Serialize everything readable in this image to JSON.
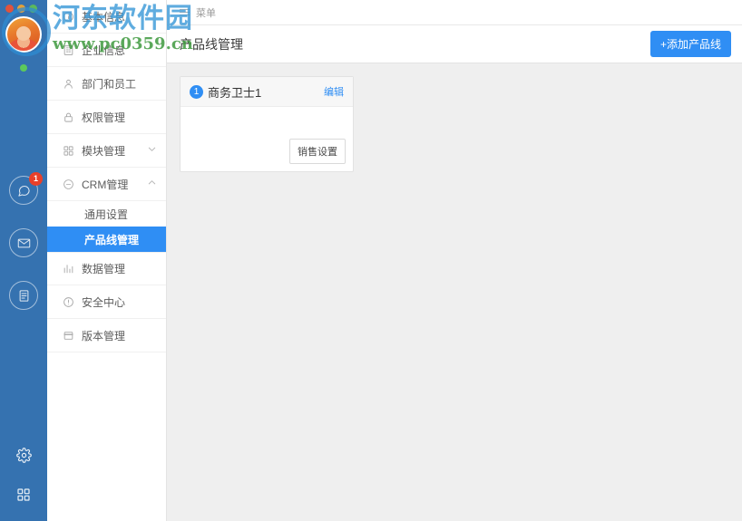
{
  "window": {
    "traffic_lights": [
      {
        "name": "close",
        "color": "#e0533d"
      },
      {
        "name": "minimize",
        "color": "#e3a13a"
      },
      {
        "name": "maximize",
        "color": "#5cb85c"
      }
    ],
    "status_dot_color": "#5cc95c",
    "rail_color": "#3572b0"
  },
  "rail": {
    "icons": [
      {
        "name": "chat-icon",
        "glyph": "chat",
        "badge": "1"
      },
      {
        "name": "mail-icon",
        "glyph": "mail",
        "badge": ""
      },
      {
        "name": "notes-icon",
        "glyph": "notes",
        "badge": ""
      }
    ],
    "bottom_icons": [
      {
        "name": "settings-icon",
        "glyph": "gear"
      },
      {
        "name": "apps-icon",
        "glyph": "grid"
      }
    ]
  },
  "sidebar": {
    "items": [
      {
        "label": "基本信息",
        "icon": "info-icon",
        "has_chevron": false,
        "chevron": "",
        "obscured": true
      },
      {
        "label": "企业信息",
        "icon": "building-icon",
        "has_chevron": false,
        "chevron": "",
        "obscured": true
      },
      {
        "label": "部门和员工",
        "icon": "user-icon",
        "has_chevron": false,
        "chevron": ""
      },
      {
        "label": "权限管理",
        "icon": "lock-icon",
        "has_chevron": false,
        "chevron": ""
      },
      {
        "label": "模块管理",
        "icon": "modules-icon",
        "has_chevron": true,
        "chevron": "⌄"
      },
      {
        "label": "CRM管理",
        "icon": "crm-icon",
        "has_chevron": true,
        "chevron": "⌃"
      }
    ],
    "crm_subitems": [
      {
        "label": "通用设置",
        "active": false
      },
      {
        "label": "产品线管理",
        "active": true
      }
    ],
    "items_after": [
      {
        "label": "数据管理",
        "icon": "chart-icon",
        "has_chevron": false,
        "chevron": ""
      },
      {
        "label": "安全中心",
        "icon": "alert-icon",
        "has_chevron": false,
        "chevron": ""
      },
      {
        "label": "版本管理",
        "icon": "window-icon",
        "has_chevron": false,
        "chevron": ""
      }
    ],
    "active_color": "#2f8ef4"
  },
  "menubar": {
    "label": "菜单"
  },
  "header": {
    "title": "产品线管理",
    "add_button": "+添加产品线",
    "accent_color": "#2f8ef4"
  },
  "cards": [
    {
      "number": "1",
      "title": "商务卫士1",
      "edit_label": "编辑",
      "action_label": "销售设置"
    }
  ],
  "watermark": {
    "site_name": "河东软件园",
    "url": "www.pc0359.cn"
  }
}
